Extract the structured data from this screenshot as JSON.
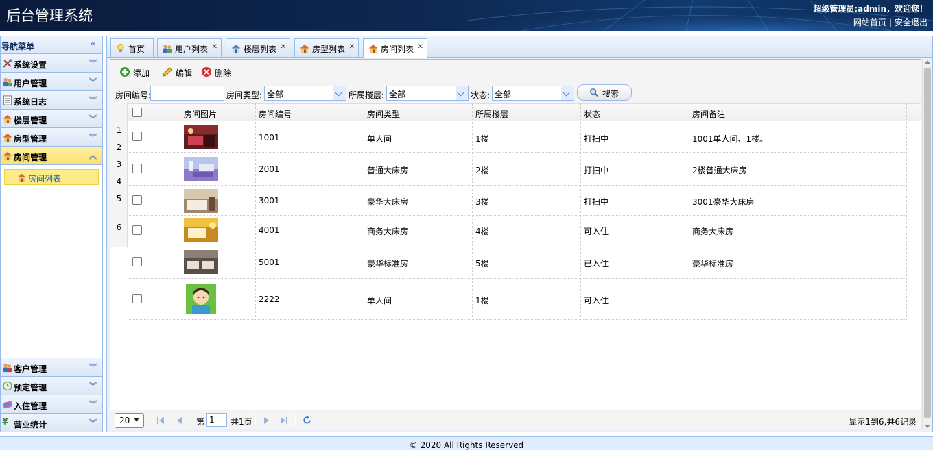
{
  "header": {
    "title": "后台管理系统",
    "user_greeting": "超级管理员:admin，欢迎您！",
    "link_home": "网站首页",
    "link_logout": "安全退出"
  },
  "sidebar": {
    "title": "导航菜单",
    "panels_top": [
      {
        "label": "系统设置",
        "icon": "tools-icon"
      },
      {
        "label": "用户管理",
        "icon": "users-icon"
      },
      {
        "label": "系统日志",
        "icon": "log-icon"
      },
      {
        "label": "楼层管理",
        "icon": "house-icon"
      },
      {
        "label": "房型管理",
        "icon": "house-icon"
      },
      {
        "label": "房间管理",
        "icon": "house-icon"
      }
    ],
    "active_sub_item": "房间列表",
    "panels_bottom": [
      {
        "label": "客户管理",
        "icon": "customers-icon"
      },
      {
        "label": "预定管理",
        "icon": "clock-icon"
      },
      {
        "label": "入住管理",
        "icon": "checkin-icon"
      },
      {
        "label": "营业统计",
        "icon": "yen-icon"
      }
    ]
  },
  "tabs": [
    {
      "label": "首页",
      "icon": "bulb-icon",
      "closable": false
    },
    {
      "label": "用户列表",
      "icon": "users-icon",
      "closable": true
    },
    {
      "label": "楼层列表",
      "icon": "house-icon",
      "closable": true
    },
    {
      "label": "房型列表",
      "icon": "house-icon",
      "closable": true
    },
    {
      "label": "房间列表",
      "icon": "house-icon",
      "closable": true,
      "active": true
    }
  ],
  "toolbar": {
    "add_label": "添加",
    "edit_label": "编辑",
    "delete_label": "删除"
  },
  "filters": {
    "room_no_label": "房间编号:",
    "room_no_value": "",
    "room_type_label": "房间类型:",
    "room_type_value": "全部",
    "floor_label": "所属楼层:",
    "floor_value": "全部",
    "status_label": "状态:",
    "status_value": "全部",
    "search_label": "搜索"
  },
  "table": {
    "columns": [
      "房间图片",
      "房间编号",
      "房间类型",
      "所属楼层",
      "状态",
      "房间备注"
    ],
    "row_numbers": [
      "1",
      "2",
      "3",
      "4",
      "5",
      "6"
    ],
    "rows": [
      {
        "image": "room-photo-red",
        "no": "1001",
        "type": "单人间",
        "floor": "1楼",
        "status": "打扫中",
        "note": "1001单人间、1楼。"
      },
      {
        "image": "room-photo-purple",
        "no": "2001",
        "type": "普通大床房",
        "floor": "2楼",
        "status": "打扫中",
        "note": "2楼普通大床房"
      },
      {
        "image": "room-photo-beige",
        "no": "3001",
        "type": "豪华大床房",
        "floor": "3楼",
        "status": "打扫中",
        "note": "3001豪华大床房"
      },
      {
        "image": "room-photo-gold",
        "no": "4001",
        "type": "商务大床房",
        "floor": "4楼",
        "status": "可入住",
        "note": "商务大床房"
      },
      {
        "image": "room-photo-twin",
        "no": "5001",
        "type": "豪华标准房",
        "floor": "5楼",
        "status": "已入住",
        "note": "豪华标准房"
      },
      {
        "image": "avatar-cartoon",
        "no": "2222",
        "type": "单人间",
        "floor": "1楼",
        "status": "可入住",
        "note": ""
      }
    ]
  },
  "pager": {
    "page_size": "20",
    "page_prefix": "第",
    "page_value": "1",
    "page_total": "共1页",
    "info": "显示1到6,共6记录"
  },
  "footer": {
    "copyright": "© 2020 All Rights Reserved"
  }
}
